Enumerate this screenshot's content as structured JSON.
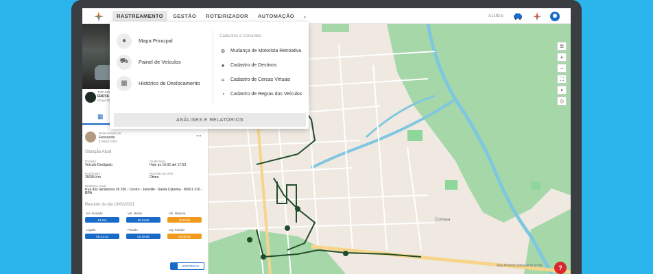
{
  "nav": {
    "items": [
      "RASTREAMENTO",
      "GESTÃO",
      "ROTEIRIZADOR",
      "AUTOMAÇÃO"
    ],
    "help": "AJUDA"
  },
  "dropdown": {
    "left_items": [
      "Mapa Principal",
      "Painel de Veículos",
      "Histórico de Deslocamento"
    ],
    "right_heading": "Cadastros e Consultas",
    "right_items": [
      "Mudança de Motorista Retroativa",
      "Cadastro de Destinos",
      "Cadastro de Cercas Virtuais",
      "Cadastro de Regras dos Veículos"
    ],
    "footer": "ANÁLISES E RELATÓRIOS"
  },
  "vehicle": {
    "line1": "TMP-5622",
    "name": "FROTA D",
    "line3": "Ocupi 202"
  },
  "driver": {
    "label": "Relacionado por",
    "name": "Fernando",
    "phone": "47991077407"
  },
  "status": {
    "title": "Situação Atual",
    "fields": [
      {
        "label": "Posição",
        "value": "Veículo Desligado"
      },
      {
        "label": "Atualização",
        "value": "Hoje às 16:02 até 17:53"
      },
      {
        "label": "Hodômetro",
        "value": "25095 Km"
      },
      {
        "label": "Precisão do GPS",
        "value": "Ótima"
      },
      {
        "label": "Endereço Atual",
        "value": "Rua dos Ginásticos 26 256 - Centro - Joinville - Santa Catarina - 89201 310 - BRA"
      }
    ]
  },
  "summary": {
    "title": "Resumo do dia 19/02/2021",
    "metrics": [
      {
        "label": "Km Rodado",
        "value": "14 Km",
        "color": "blue"
      },
      {
        "label": "Vel. Média",
        "value": "15 Km/h",
        "color": "blue"
      },
      {
        "label": "Vel. Máxima",
        "value": "49 Km/h",
        "color": "orange"
      },
      {
        "label": "Ligado",
        "value": "05:41:43",
        "color": "blue"
      },
      {
        "label": "Parado",
        "value": "02:29:56",
        "color": "blue"
      },
      {
        "label": "Lig. Parado",
        "value": "00:08:58",
        "color": "orange"
      }
    ],
    "history_button": "HISTÓRICO"
  },
  "map": {
    "labels": [
      "Comasa",
      "Rua Prefeito Baltasar Buschle"
    ]
  },
  "colors": {
    "accent": "#1a6bc7",
    "warning": "#f19a1e",
    "water": "#7fc7e0",
    "park": "#8fd69a",
    "route": "#1f4d2b"
  }
}
